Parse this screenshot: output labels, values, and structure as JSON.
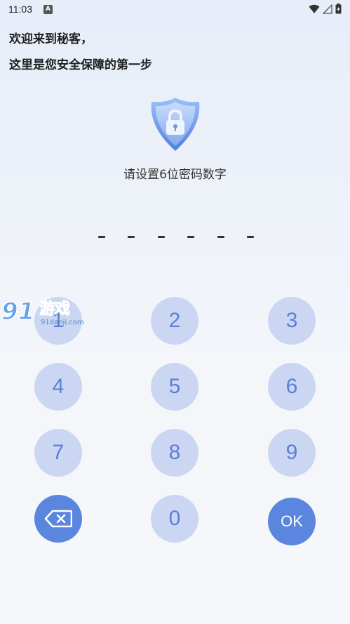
{
  "status_bar": {
    "time": "11:03",
    "notification_icon_letter": "A"
  },
  "welcome": {
    "line1": "欢迎来到秘客，",
    "line2": "这里是您安全保障的第一步"
  },
  "instruction": "请设置6位密码数字",
  "pin": {
    "length": 6,
    "entered": 0,
    "placeholder_char": "-"
  },
  "keypad": {
    "keys": [
      "1",
      "2",
      "3",
      "4",
      "5",
      "6",
      "7",
      "8",
      "9",
      "",
      "0",
      "OK"
    ],
    "delete_icon": "backspace-icon",
    "ok_label": "OK"
  },
  "watermark": {
    "logo_text": "91游戏",
    "url_text": "91danji.com"
  },
  "colors": {
    "key_bg": "#cbd7f2",
    "key_text": "#5b7fd6",
    "accent": "#5b86e0"
  }
}
